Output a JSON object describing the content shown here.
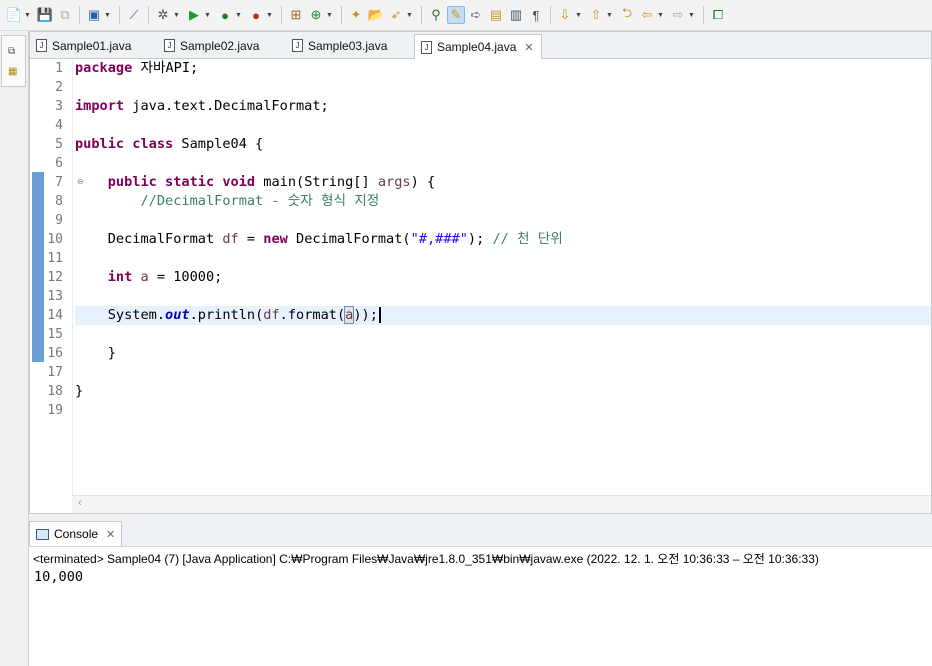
{
  "toolbar": {
    "icons": [
      "new-icon",
      "save-icon",
      "save-all-icon",
      "terminal-icon",
      "skip-breakpoints-icon",
      "debug-icon",
      "run-icon",
      "coverage-icon",
      "external-tools-icon",
      "new-java-package-icon",
      "new-java-class-icon",
      "open-type-icon",
      "open-task-icon",
      "search-icon",
      "annotation-icon",
      "toggle-mark-occurrences-icon",
      "highlight-icon",
      "java-editor-icon",
      "toggle-block-selection-icon",
      "show-whitespace-icon",
      "next-annotation-icon",
      "previous-annotation-icon",
      "last-edit-location-icon",
      "back-icon",
      "forward-icon",
      "open-perspective-icon"
    ]
  },
  "editor": {
    "tabs": [
      {
        "label": "Sample01.java",
        "active": false
      },
      {
        "label": "Sample02.java",
        "active": false
      },
      {
        "label": "Sample03.java",
        "active": false
      },
      {
        "label": "Sample04.java",
        "active": true
      }
    ],
    "line_numbers": [
      "1",
      "2",
      "3",
      "4",
      "5",
      "6",
      "7",
      "8",
      "9",
      "10",
      "11",
      "12",
      "13",
      "14",
      "15",
      "16",
      "17",
      "18",
      "19"
    ],
    "code": {
      "l1_kw": "package",
      "l1_rest": " 자바API;",
      "l3_kw": "import",
      "l3_rest": " java.text.DecimalFormat;",
      "l5_kw1": "public",
      "l5_kw2": "class",
      "l5_rest": " Sample04 {",
      "l7_kw1": "public",
      "l7_kw2": "static",
      "l7_kw3": "void",
      "l7_mid": " main(String[] ",
      "l7_var": "args",
      "l7_end": ") {",
      "l8_comment": "//DecimalFormat - 숫자 형식 지정",
      "l10_a": "DecimalFormat ",
      "l10_var": "df",
      "l10_b": " = ",
      "l10_kw": "new",
      "l10_c": " DecimalFormat(",
      "l10_str": "\"#,###\"",
      "l10_d": "); ",
      "l10_comment": "// 천 단위",
      "l12_kw": "int",
      "l12_sp": " ",
      "l12_var": "a",
      "l12_rest": " = 10000;",
      "l14_a": "System.",
      "l14_field": "out",
      "l14_b": ".println(",
      "l14_var": "df",
      "l14_c": ".format(",
      "l14_arg": "a",
      "l14_d": "));",
      "l16": "}",
      "l18": "}"
    }
  },
  "console": {
    "tab_label": "Console",
    "status": "<terminated> Sample04 (7) [Java Application] C:₩Program Files₩Java₩jre1.8.0_351₩bin₩javaw.exe  (2022. 12. 1. 오전 10:36:33 – 오전 10:36:33)",
    "output": "10,000"
  }
}
